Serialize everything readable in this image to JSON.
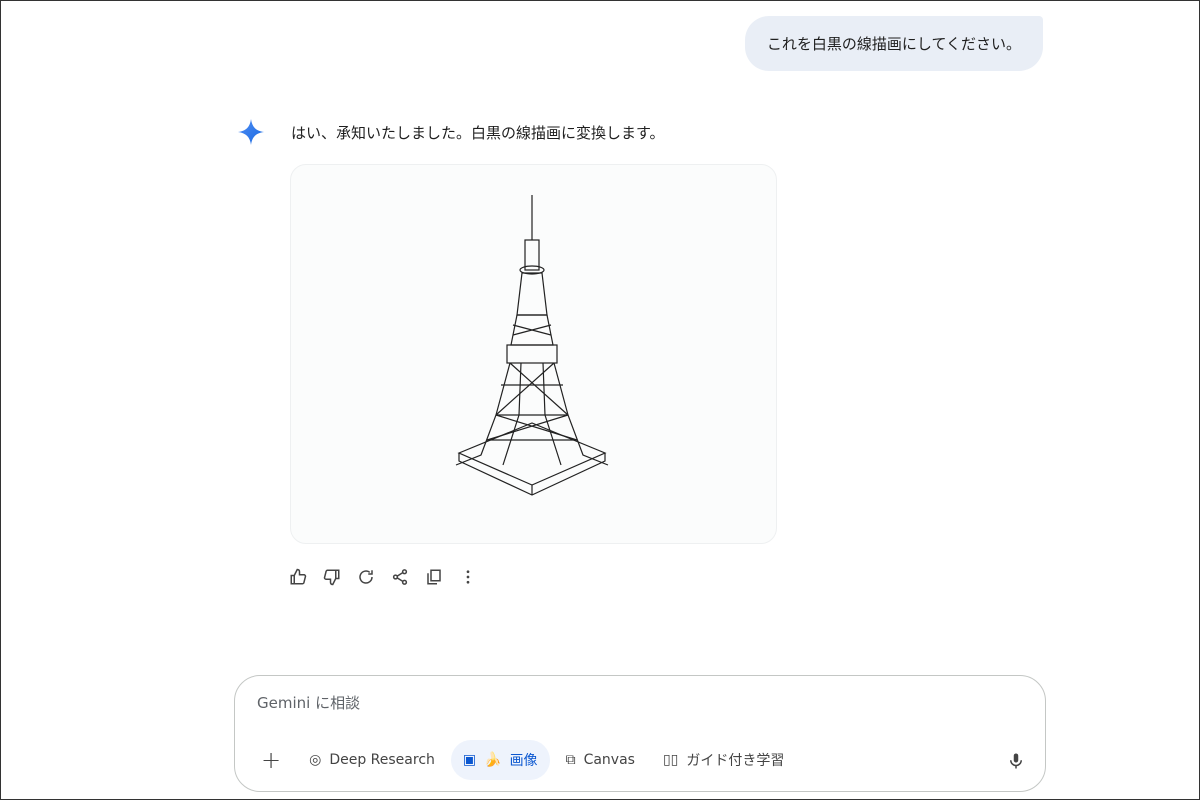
{
  "conversation": {
    "user_message": "これを白黒の線描画にしてください。",
    "assistant_reply": "はい、承知いたしました。白黒の線描画に変換します。",
    "image": {
      "subject": "tokyo-tower-line-drawing"
    }
  },
  "actions": [
    "thumbs-up",
    "thumbs-down",
    "regenerate",
    "share",
    "copy",
    "more"
  ],
  "composer": {
    "placeholder": "Gemini に相談",
    "tools": {
      "add": "+",
      "deep_research": "Deep Research",
      "image": "画像",
      "image_emoji": "🍌",
      "canvas": "Canvas",
      "guided_learning": "ガイド付き学習"
    }
  },
  "colors": {
    "accent": "#0b57d0",
    "bubble": "#e9eef6"
  }
}
